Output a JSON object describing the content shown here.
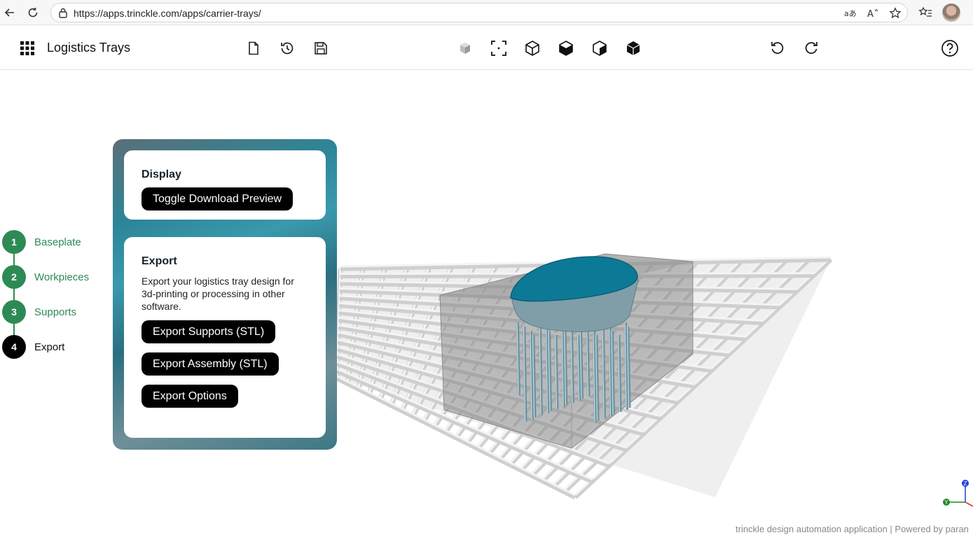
{
  "browser": {
    "url": "https://apps.trinckle.com/apps/carrier-trays/"
  },
  "header": {
    "title": "Logistics Trays"
  },
  "stepper": {
    "steps": [
      {
        "number": "1",
        "label": "Baseplate",
        "state": "done"
      },
      {
        "number": "2",
        "label": "Workpieces",
        "state": "done"
      },
      {
        "number": "3",
        "label": "Supports",
        "state": "done"
      },
      {
        "number": "4",
        "label": "Export",
        "state": "active"
      }
    ]
  },
  "display_card": {
    "title": "Display",
    "toggle_label": "Toggle Download Preview"
  },
  "export_card": {
    "title": "Export",
    "description": "Export your logistics tray design for 3d-printing or processing in other software.",
    "buttons": [
      "Export Supports (STL)",
      "Export Assembly (STL)",
      "Export Options"
    ]
  },
  "axes": {
    "x": "X",
    "y": "Y",
    "z": "Z"
  },
  "footer": {
    "text": "trinckle design automation application | Powered by paran"
  },
  "colors": {
    "accent_green": "#2e8a54",
    "workpiece_blue": "#0c7a97",
    "grid": "#d8d8d8"
  }
}
